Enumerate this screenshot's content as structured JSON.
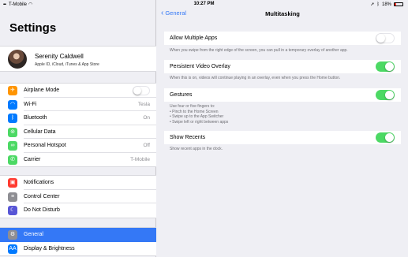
{
  "status_bar": {
    "carrier": "T-Mobile",
    "time": "10:27 PM",
    "battery": "18%"
  },
  "sidebar": {
    "title": "Settings",
    "profile": {
      "name": "Serenity Caldwell",
      "subtitle": "Apple ID, iCloud, iTunes & App Store"
    },
    "group1": [
      {
        "label": "Airplane Mode",
        "icon": "airplane-icon",
        "color": "#ff9500",
        "toggle": false
      },
      {
        "label": "Wi-Fi",
        "icon": "wifi-icon",
        "color": "#007aff",
        "value": "Tesla"
      },
      {
        "label": "Bluetooth",
        "icon": "bluetooth-icon",
        "color": "#007aff",
        "value": "On"
      },
      {
        "label": "Cellular Data",
        "icon": "cellular-icon",
        "color": "#4cd964"
      },
      {
        "label": "Personal Hotspot",
        "icon": "hotspot-icon",
        "color": "#4cd964",
        "value": "Off"
      },
      {
        "label": "Carrier",
        "icon": "phone-icon",
        "color": "#4cd964",
        "value": "T-Mobile"
      }
    ],
    "group2": [
      {
        "label": "Notifications",
        "icon": "notifications-icon",
        "color": "#ff3b30"
      },
      {
        "label": "Control Center",
        "icon": "control-center-icon",
        "color": "#8e8e93"
      },
      {
        "label": "Do Not Disturb",
        "icon": "moon-icon",
        "color": "#5856d6"
      }
    ],
    "group3": [
      {
        "label": "General",
        "icon": "gear-icon",
        "color": "#8e8e93",
        "selected": true
      },
      {
        "label": "Display & Brightness",
        "icon": "display-icon",
        "color": "#007aff"
      }
    ]
  },
  "detail": {
    "back_label": "General",
    "title": "Multitasking",
    "allow_multiple_apps": {
      "label": "Allow Multiple Apps",
      "on": false,
      "footer": "When you swipe from the right edge of the screen, you can pull in a temporary overlay of another app."
    },
    "persistent_video": {
      "label": "Persistent Video Overlay",
      "on": true,
      "footer": "When this is on, videos will continue playing in an overlay, even when you press the Home button."
    },
    "gestures": {
      "label": "Gestures",
      "on": true,
      "footer_lines": [
        "Use four or five fingers to:",
        "• Pinch to the Home Screen",
        "• Swipe up to the App Switcher",
        "• Swipe left or right between apps"
      ]
    },
    "show_recents": {
      "label": "Show Recents",
      "on": true,
      "footer": "Show recent apps in the dock."
    }
  }
}
